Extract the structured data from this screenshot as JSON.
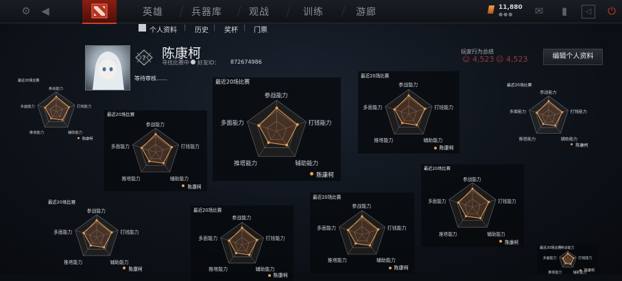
{
  "topbar": {
    "menu": [
      "英雄",
      "兵器库",
      "观战",
      "训练",
      "游廊"
    ],
    "currency": "11,880",
    "currency_dots": "●●●"
  },
  "subnav": {
    "items": [
      "个人资料",
      "历史",
      "奖杯",
      "门票"
    ],
    "separators": [
      "|",
      "|",
      "|"
    ]
  },
  "profile": {
    "name": "陈康柯",
    "status": "寻找比赛中",
    "friend_id_label": "好友ID：",
    "friend_id": "872674986",
    "pending": "等待审核……",
    "behavior_label": "玩家行为总结",
    "behavior_scores": [
      "4,523",
      "4,523"
    ],
    "edit_button": "编辑个人资料"
  },
  "radar": {
    "title": "最近20场比赛",
    "axes": [
      "参战能力",
      "打钱能力",
      "辅助能力",
      "推塔能力",
      "多面能力"
    ],
    "legend": "陈康柯",
    "values": [
      0.75,
      0.7,
      0.55,
      0.45,
      0.6
    ],
    "colors": {
      "line": "#e6a25a",
      "fill": "rgba(210,120,60,0.22)",
      "web": "#6a6f76",
      "panel": "#07090c"
    }
  }
}
